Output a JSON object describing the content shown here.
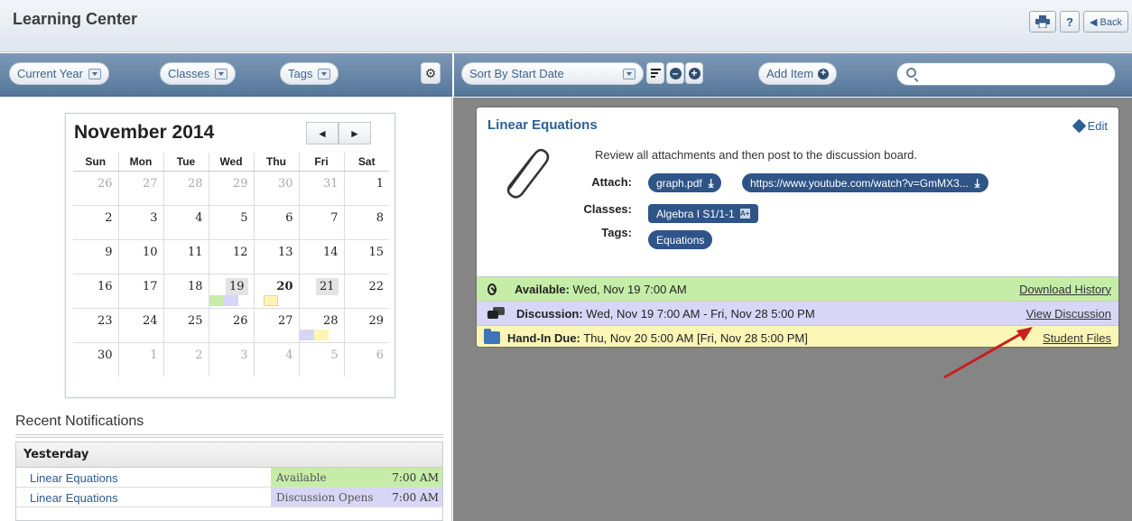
{
  "header": {
    "title": "Learning Center",
    "help_label": "?",
    "back_label": "◀ Back"
  },
  "left_toolbar": {
    "current_year": "Current Year",
    "classes": "Classes",
    "tags": "Tags"
  },
  "right_toolbar": {
    "sort": "Sort By Start Date",
    "add_item": "Add Item",
    "search_placeholder": ""
  },
  "calendar": {
    "month_title": "November 2014",
    "prev": "◄",
    "next": "►",
    "weekdays": [
      "Sun",
      "Mon",
      "Tue",
      "Wed",
      "Thu",
      "Fri",
      "Sat"
    ],
    "weeks": [
      [
        "26",
        "27",
        "28",
        "29",
        "30",
        "31",
        "1"
      ],
      [
        "2",
        "3",
        "4",
        "5",
        "6",
        "7",
        "8"
      ],
      [
        "9",
        "10",
        "11",
        "12",
        "13",
        "14",
        "15"
      ],
      [
        "16",
        "17",
        "18",
        "19",
        "20",
        "21",
        "22"
      ],
      [
        "23",
        "24",
        "25",
        "26",
        "27",
        "28",
        "29"
      ],
      [
        "30",
        "1",
        "2",
        "3",
        "4",
        "5",
        "6"
      ]
    ]
  },
  "notifications": {
    "title": "Recent Notifications",
    "group": "Yesterday",
    "rows": [
      {
        "title": "Linear Equations",
        "status": "Available",
        "time": "7:00 AM",
        "color": "#c6eda8"
      },
      {
        "title": "Linear Equations",
        "status": "Discussion Opens",
        "time": "7:00 AM",
        "color": "#d8d6f6"
      }
    ]
  },
  "item": {
    "title": "Linear Equations",
    "edit": "Edit",
    "description": "Review all attachments and then post to the discussion board.",
    "attach_label": "Attach:",
    "attachments": [
      "graph.pdf",
      "https://www.youtube.com/watch?v=GmMX3..."
    ],
    "classes_label": "Classes:",
    "class_name": "Algebra I S1/1-1",
    "tags_label": "Tags:",
    "tag": "Equations",
    "available_label": "Available:",
    "available_value": " Wed, Nov 19 7:00 AM",
    "available_link": "Download History",
    "discussion_label": "Discussion:",
    "discussion_value": " Wed, Nov 19 7:00 AM - Fri, Nov 28 5:00 PM",
    "discussion_link": "View Discussion",
    "handin_label": "Hand-In Due:",
    "handin_value": " Thu, Nov 20 5:00 AM [Fri, Nov 28 5:00 PM]",
    "handin_link": "Student Files"
  },
  "colors": {
    "available": "#c6eda8",
    "discussion": "#d8d6f6",
    "handin": "#fbf6b6",
    "accent": "#2e5488"
  }
}
